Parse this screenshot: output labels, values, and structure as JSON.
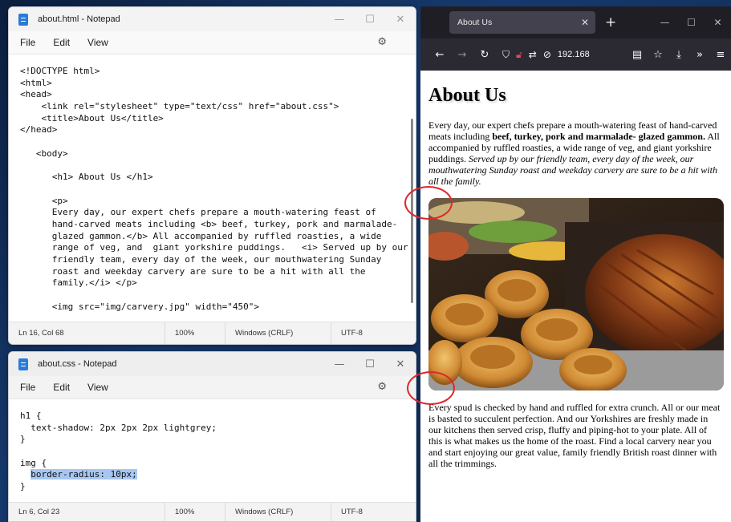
{
  "notepad_html": {
    "title": "about.html - Notepad",
    "menu": [
      "File",
      "Edit",
      "View"
    ],
    "code_lines": [
      "<!DOCTYPE html>",
      "<html>",
      "<head>",
      "    <link rel=\"stylesheet\" type=\"text/css\" href=\"about.css\">",
      "    <title>About Us</title>",
      "</head>",
      "",
      "   <body>",
      "",
      "      <h1> About Us </h1>",
      "",
      "      <p>",
      "      Every day, our expert chefs prepare a mouth-watering feast of",
      "      hand-carved meats including <b> beef, turkey, pork and marmalade-",
      "      glazed gammon.</b> All accompanied by ruffled roasties, a wide",
      "      range of veg, and  giant yorkshire puddings.   <i> Served up by our",
      "      friendly team, every day of the week, our mouthwatering Sunday",
      "      roast and weekday carvery are sure to be a hit with all the",
      "      family.</i> </p>",
      "",
      "      <img src=\"img/carvery.jpg\" width=\"450\">"
    ],
    "status": {
      "position": "Ln 16, Col 68",
      "zoom": "100%",
      "line_ending": "Windows (CRLF)",
      "encoding": "UTF-8"
    }
  },
  "notepad_css": {
    "title": "about.css - Notepad",
    "menu": [
      "File",
      "Edit",
      "View"
    ],
    "code_lines": [
      "h1 {",
      "  text-shadow: 2px 2px 2px lightgrey;",
      "}",
      "",
      "img {",
      "  border-radius: 10px;",
      "}"
    ],
    "selected_text": "border-radius: 10px;",
    "status": {
      "position": "Ln 6, Col 23",
      "zoom": "100%",
      "line_ending": "Windows (CRLF)",
      "encoding": "UTF-8"
    }
  },
  "window_controls": {
    "minimize": "—",
    "maximize": "☐",
    "close": "✕"
  },
  "browser": {
    "tab_title": "About Us",
    "tab_close": "✕",
    "new_tab": "+",
    "url": "192.168",
    "page": {
      "heading": "About Us",
      "p1_start": "Every day, our expert chefs prepare a mouth-watering feast of hand-carved meats including ",
      "p1_bold": "beef, turkey, pork and marmalade- glazed gammon.",
      "p1_mid": " All accompanied by ruffled roasties, a wide range of veg, and giant yorkshire puddings. ",
      "p1_italic": "Served up by our friendly team, every day of the week, our mouthwatering Sunday roast and weekday carvery are sure to be a hit with all the family.",
      "p2": "Every spud is checked by hand and ruffled for extra crunch. All or our meat is basted to succulent perfection. And our Yorkshires are freshly made in our kitchens then served crisp, fluffy and piping-hot to your plate. All of this is what makes us the home of the roast. Find a local carvery near you and start enjoying our great value, family friendly British roast dinner with all the trimmings."
    }
  },
  "colors": {
    "annotation": "#e0262b",
    "selection": "#a7c7f2",
    "browser_chrome": "#2b2a33"
  }
}
